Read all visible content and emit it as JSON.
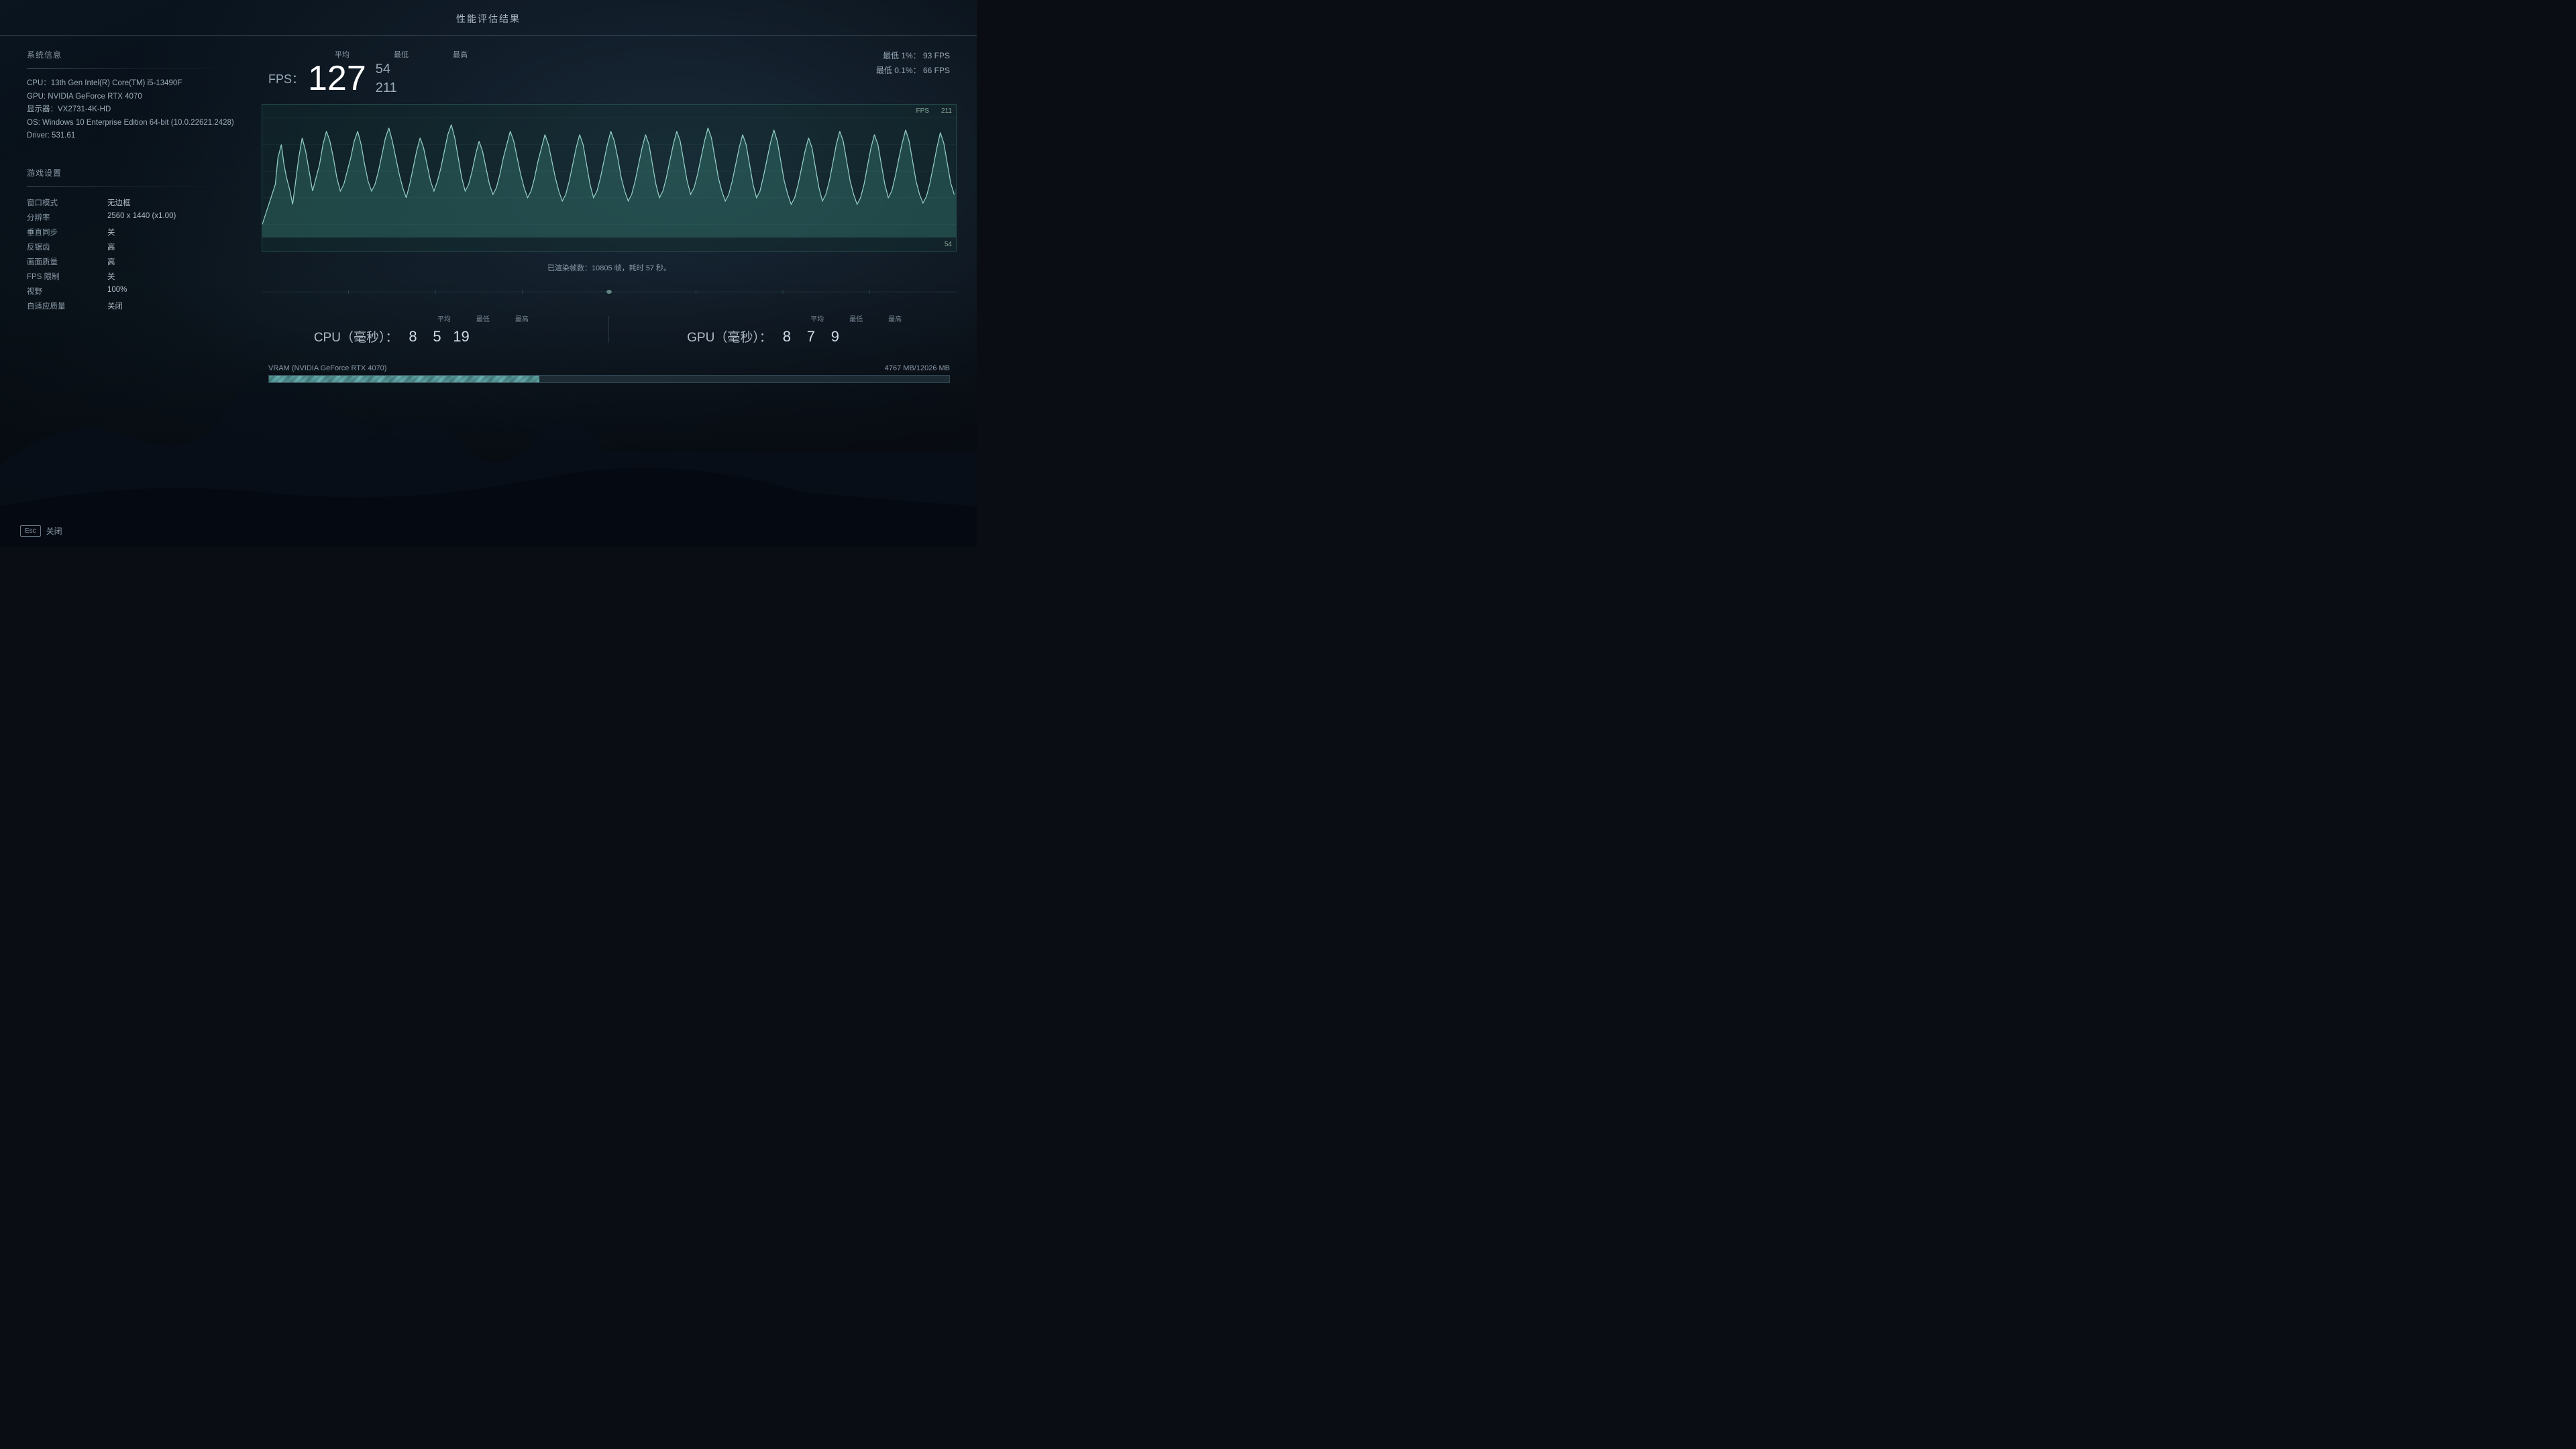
{
  "title": "性能评估结果",
  "system_info": {
    "section_label": "系统信息",
    "cpu": "CPU：13th Gen Intel(R) Core(TM) i5-13490F",
    "gpu": "GPU: NVIDIA GeForce RTX 4070",
    "display": "显示器：VX2731-4K-HD",
    "os": "OS: Windows 10 Enterprise Edition 64-bit (10.0.22621.2428)",
    "driver": "Driver: 531.61"
  },
  "game_settings": {
    "section_label": "游戏设置",
    "rows": [
      {
        "label": "窗口模式",
        "value": "无边框"
      },
      {
        "label": "分辨率",
        "value": "2560 x 1440 (x1.00)"
      },
      {
        "label": "垂直同步",
        "value": "关"
      },
      {
        "label": "反锯齿",
        "value": "高"
      },
      {
        "label": "画面质量",
        "value": "高"
      },
      {
        "label": "FPS 限制",
        "value": "关"
      },
      {
        "label": "视野",
        "value": "100%"
      },
      {
        "label": "自适应质量",
        "value": "关闭"
      }
    ]
  },
  "fps": {
    "label": "FPS：",
    "avg": "127",
    "min": "54",
    "max": "211",
    "headers": {
      "avg": "平均",
      "min": "最低",
      "max": "最高"
    },
    "percentile_1": "最低 1%：  93 FPS",
    "percentile_01": "最低 0.1%：  66 FPS",
    "chart_max": "211",
    "chart_min": "54",
    "chart_fps_label": "FPS"
  },
  "render_info": "已渲染帧数：10805 帧，耗时 57 秒。",
  "cpu_stats": {
    "label": "CPU（毫秒）：",
    "avg": "8",
    "min": "5",
    "max": "19",
    "headers": {
      "avg": "平均",
      "min": "最低",
      "max": "最高"
    }
  },
  "gpu_stats": {
    "label": "GPU（毫秒）：",
    "avg": "8",
    "min": "7",
    "max": "9",
    "headers": {
      "avg": "平均",
      "min": "最低",
      "max": "最高"
    }
  },
  "vram": {
    "label": "VRAM (NVIDIA GeForce RTX 4070)",
    "used": "4767 MB",
    "total": "12026 MB",
    "display": "4767 MB/12026 MB",
    "percent": 39.7
  },
  "esc_button": "Esc",
  "close_label": "关闭"
}
